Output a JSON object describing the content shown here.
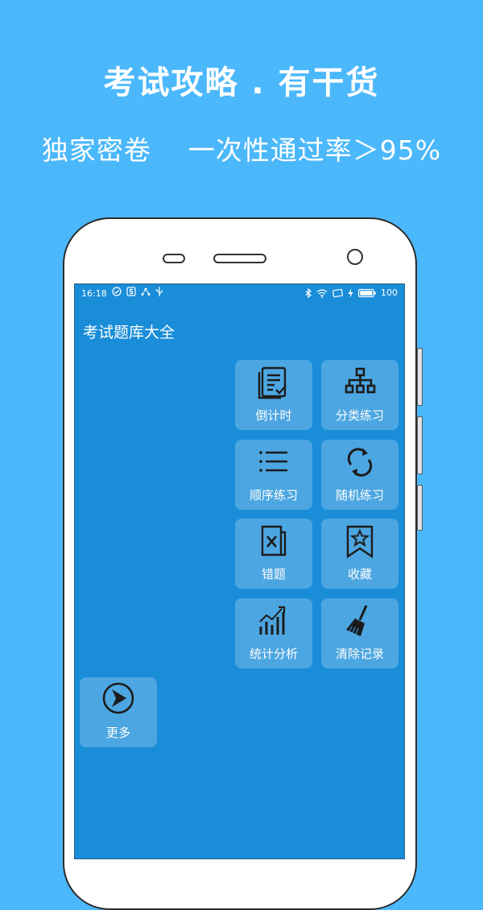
{
  "promo": {
    "headline": "考试攻略 . 有干货",
    "subline": "独家密卷    一次性通过率＞95%"
  },
  "status_bar": {
    "time": "16:18",
    "battery": "100",
    "left_icons": [
      "check-circle-icon",
      "five-g-icon",
      "share-icon",
      "usb-icon"
    ],
    "right_icons": [
      "bluetooth-icon",
      "wifi-icon",
      "screen-icon",
      "charging-icon",
      "battery-icon"
    ]
  },
  "app": {
    "title": "考试题库大全"
  },
  "menu": {
    "items": [
      {
        "label": "倒计时",
        "icon": "document-list-icon"
      },
      {
        "label": "分类练习",
        "icon": "hierarchy-icon"
      },
      {
        "label": "顺序练习",
        "icon": "list-icon"
      },
      {
        "label": "随机练习",
        "icon": "refresh-icon"
      },
      {
        "label": "错题",
        "icon": "wrong-document-icon"
      },
      {
        "label": "收藏",
        "icon": "bookmark-star-icon"
      },
      {
        "label": "统计分析",
        "icon": "bar-chart-icon"
      },
      {
        "label": "清除记录",
        "icon": "broom-icon"
      },
      {
        "label": "更多",
        "icon": "arrow-circle-icon"
      }
    ]
  },
  "colors": {
    "background": "#4bb8fb",
    "screen": "#1a8dd9",
    "tile": "rgba(255,255,255,0.22)",
    "text": "#ffffff"
  }
}
